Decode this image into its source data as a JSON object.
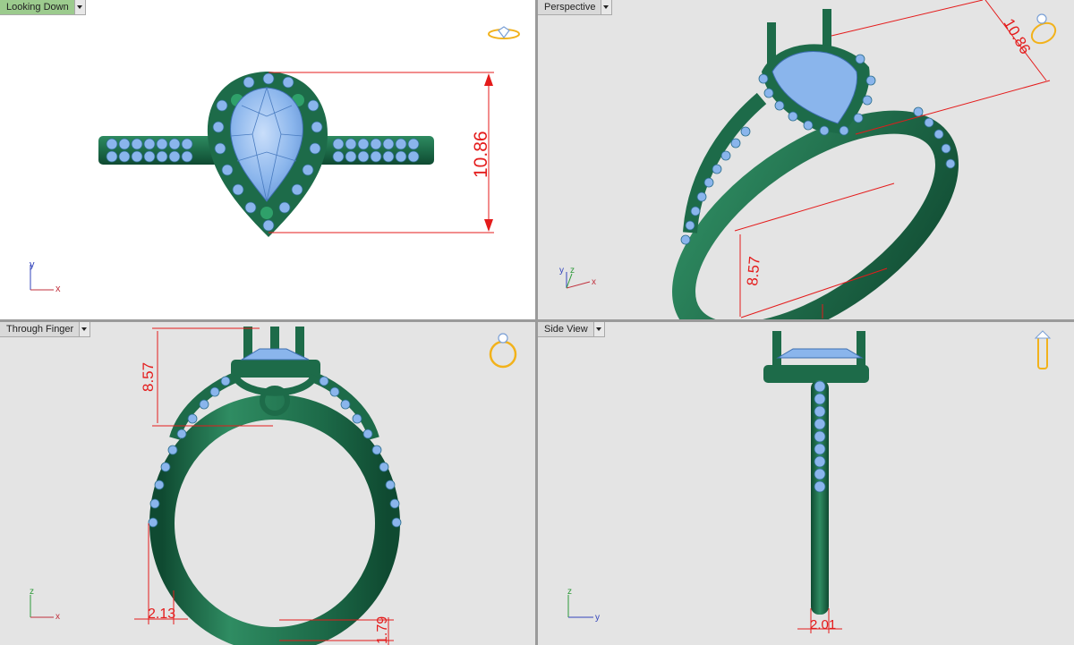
{
  "viewports": {
    "top_left": {
      "title": "Looking Down",
      "dimension": "10.86"
    },
    "top_right": {
      "title": "Perspective",
      "dimension_a": "10.86",
      "dimension_b": "8.57"
    },
    "bottom_left": {
      "title": "Through Finger",
      "dimension_a": "8.57",
      "dimension_b": "2.13",
      "dimension_c": "1.79"
    },
    "bottom_right": {
      "title": "Side View",
      "dimension": "2.01"
    }
  },
  "axes": {
    "x": "x",
    "y": "y",
    "z": "z"
  },
  "colors": {
    "metal": "#1d6b49",
    "gem": "#8ab5ec",
    "dimension": "#e41b1b",
    "active_tab": "#9ccb8e",
    "nav_icon": "#f2b21b"
  }
}
